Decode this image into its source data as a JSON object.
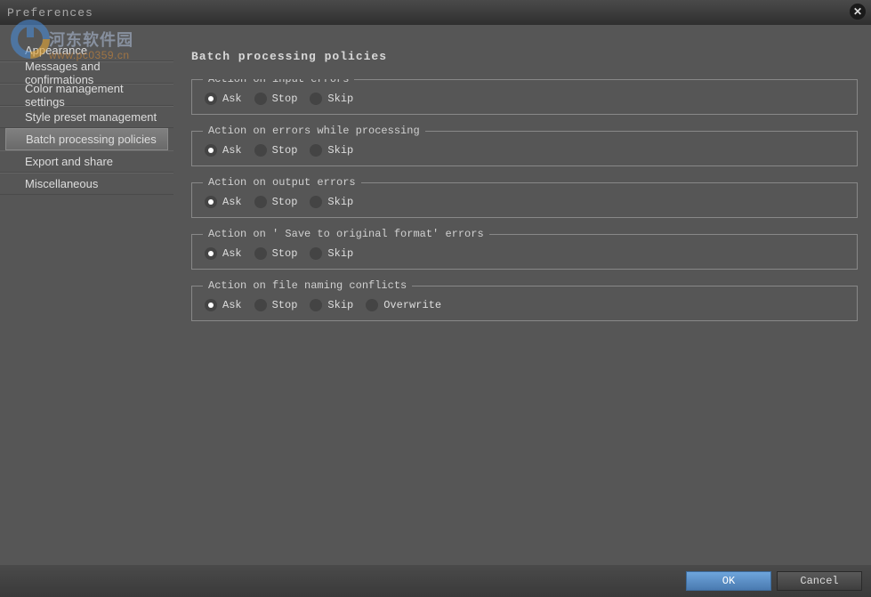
{
  "window": {
    "title": "Preferences"
  },
  "watermark": {
    "text": "河东软件园",
    "url": "www.pc0359.cn"
  },
  "sidebar": {
    "items": [
      {
        "label": "Appearance"
      },
      {
        "label": "Messages and confirmations"
      },
      {
        "label": "Color management settings"
      },
      {
        "label": "Style preset management"
      },
      {
        "label": "Batch processing policies"
      },
      {
        "label": "Export and share"
      },
      {
        "label": "Miscellaneous"
      }
    ],
    "selected": 4
  },
  "page": {
    "title": "Batch processing policies"
  },
  "groups": [
    {
      "legend": "Action on input errors",
      "options": [
        "Ask",
        "Stop",
        "Skip"
      ],
      "selected": 0
    },
    {
      "legend": "Action on errors while processing",
      "options": [
        "Ask",
        "Stop",
        "Skip"
      ],
      "selected": 0
    },
    {
      "legend": "Action on output errors",
      "options": [
        "Ask",
        "Stop",
        "Skip"
      ],
      "selected": 0
    },
    {
      "legend": "Action on ' Save to original format' errors",
      "options": [
        "Ask",
        "Stop",
        "Skip"
      ],
      "selected": 0
    },
    {
      "legend": "Action on file naming conflicts",
      "options": [
        "Ask",
        "Stop",
        "Skip",
        "Overwrite"
      ],
      "selected": 0
    }
  ],
  "footer": {
    "ok": "OK",
    "cancel": "Cancel"
  }
}
